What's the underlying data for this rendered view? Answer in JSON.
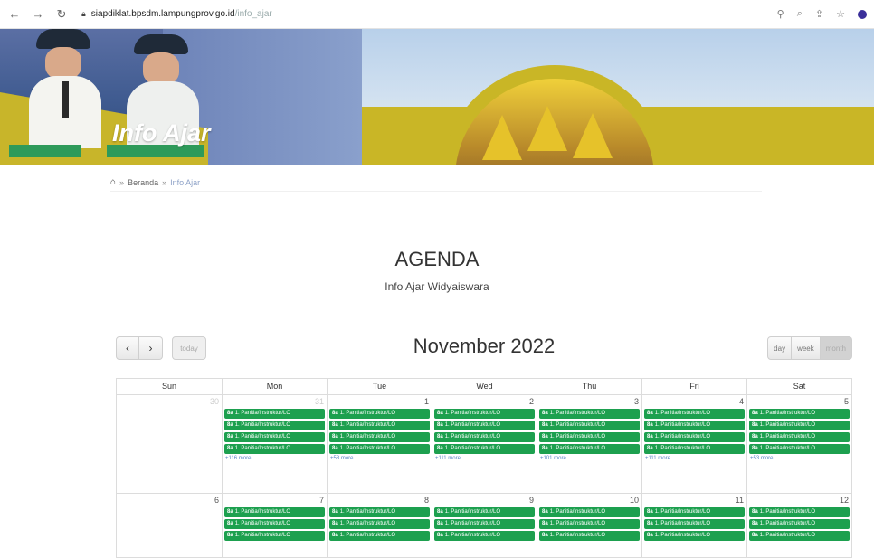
{
  "browser": {
    "url_host": "siapdiklat.bpsdm.lampungprov.go.id",
    "url_path": "/info_ajar"
  },
  "banner": {
    "title": "Info Ajar"
  },
  "breadcrumb": {
    "home_link": "Beranda",
    "current": "Info Ajar"
  },
  "heading": {
    "title": "AGENDA",
    "subtitle": "Info Ajar Widyaiswara"
  },
  "calendar": {
    "title": "November 2022",
    "today_label": "today",
    "views": [
      "day",
      "week",
      "month"
    ],
    "weekdays": [
      "Sun",
      "Mon",
      "Tue",
      "Wed",
      "Thu",
      "Fri",
      "Sat"
    ],
    "event_time": "8a",
    "event_text": "1. Panitia/Instruktur/LO",
    "weeks": [
      {
        "days": [
          {
            "num": "30",
            "other": true,
            "events": 0,
            "more": ""
          },
          {
            "num": "31",
            "other": true,
            "events": 4,
            "more": "+116 more"
          },
          {
            "num": "1",
            "other": false,
            "events": 4,
            "more": "+58 more"
          },
          {
            "num": "2",
            "other": false,
            "events": 4,
            "more": "+111 more"
          },
          {
            "num": "3",
            "other": false,
            "events": 4,
            "more": "+101 more"
          },
          {
            "num": "4",
            "other": false,
            "events": 4,
            "more": "+111 more"
          },
          {
            "num": "5",
            "other": false,
            "events": 4,
            "more": "+53 more"
          }
        ]
      },
      {
        "days": [
          {
            "num": "6",
            "other": false,
            "events": 0,
            "more": ""
          },
          {
            "num": "7",
            "other": false,
            "events": 3,
            "more": ""
          },
          {
            "num": "8",
            "other": false,
            "events": 3,
            "more": ""
          },
          {
            "num": "9",
            "other": false,
            "events": 3,
            "more": ""
          },
          {
            "num": "10",
            "other": false,
            "events": 3,
            "more": ""
          },
          {
            "num": "11",
            "other": false,
            "events": 3,
            "more": ""
          },
          {
            "num": "12",
            "other": false,
            "events": 3,
            "more": ""
          }
        ]
      }
    ]
  }
}
